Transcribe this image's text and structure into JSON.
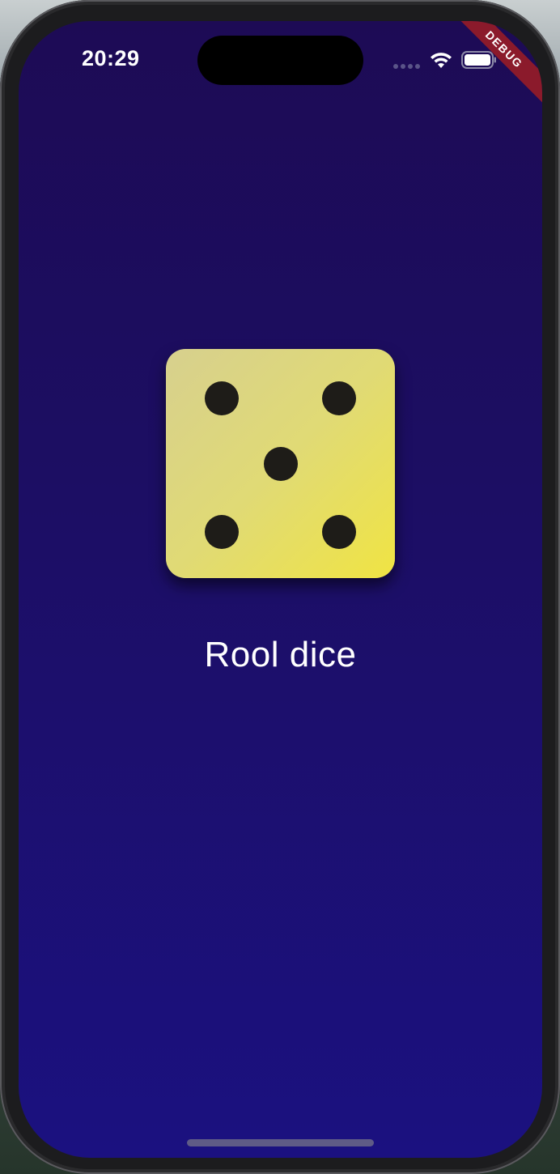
{
  "status_bar": {
    "time": "20:29",
    "signal_icon": "signal-dots-icon",
    "wifi_icon": "wifi-icon",
    "battery_icon": "battery-icon"
  },
  "debug_banner": {
    "label": "DEBUG",
    "color": "#8b1a2b"
  },
  "main": {
    "die": {
      "face_value": 5,
      "icon": "dice-five-icon",
      "colors": {
        "light": "#d7d08e",
        "bright": "#f0e443",
        "pip": "#1e1c18"
      }
    },
    "roll_label": "Rool dice"
  },
  "theme": {
    "background_top": "#1d0b55",
    "background_bottom": "#1b1180",
    "text": "#ffffff"
  }
}
